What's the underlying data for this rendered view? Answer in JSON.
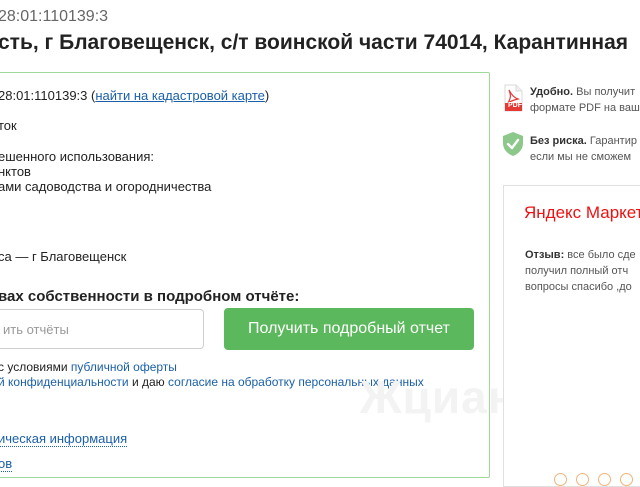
{
  "header": {
    "cad_number_partial": "28:01:110139:3",
    "title_partial": "сть, г Благовещенск, с/т воинской части 74014, Карантинная"
  },
  "card": {
    "cad_line_number": "28:01:110139:3",
    "cad_line_link": "найти на кадастровой карте",
    "area_label_partial": "ток",
    "usage_label_partial": "ешенного использования:",
    "usage_value1_partial": "нктов",
    "usage_value2_partial": "ами садоводства и огородничества",
    "city_partial": "са — г Благовещенск",
    "rights_heading_partial": "вах собственности в подробном отчёте:",
    "email_placeholder_partial": "ить отчёты",
    "cta_button": "Получить подробный отчет",
    "consent_line1_text": "с условиями",
    "consent_line1_link": "публичной оферты",
    "consent_line2_link1_partial": "й конфиденциальности",
    "consent_line2_mid": "и даю",
    "consent_line2_link2": "согласие на обработку персональных данных",
    "extra_link1_partial": "ическая информация",
    "extra_link2_partial": "ов"
  },
  "sidebar": {
    "pdf_title": "Удобно.",
    "pdf_text1": "Вы получит",
    "pdf_text2": "формате PDF на ваш",
    "pdf_icon_label": "PDF",
    "risk_title": "Без риска.",
    "risk_text1": "Гарантир",
    "risk_text2": "если мы не сможем",
    "market_logo": "Яндекс Маркет",
    "review_label": "Отзыв:",
    "review_text1": "все было сде",
    "review_text2": "получил полный отч",
    "review_text3": "вопросы спасибо ,до"
  },
  "watermark": "Жциан",
  "colors": {
    "accent_green": "#5cb85c",
    "link_blue": "#1a5fa8",
    "yandex_red": "#e11",
    "card_border": "#9fd99a"
  }
}
